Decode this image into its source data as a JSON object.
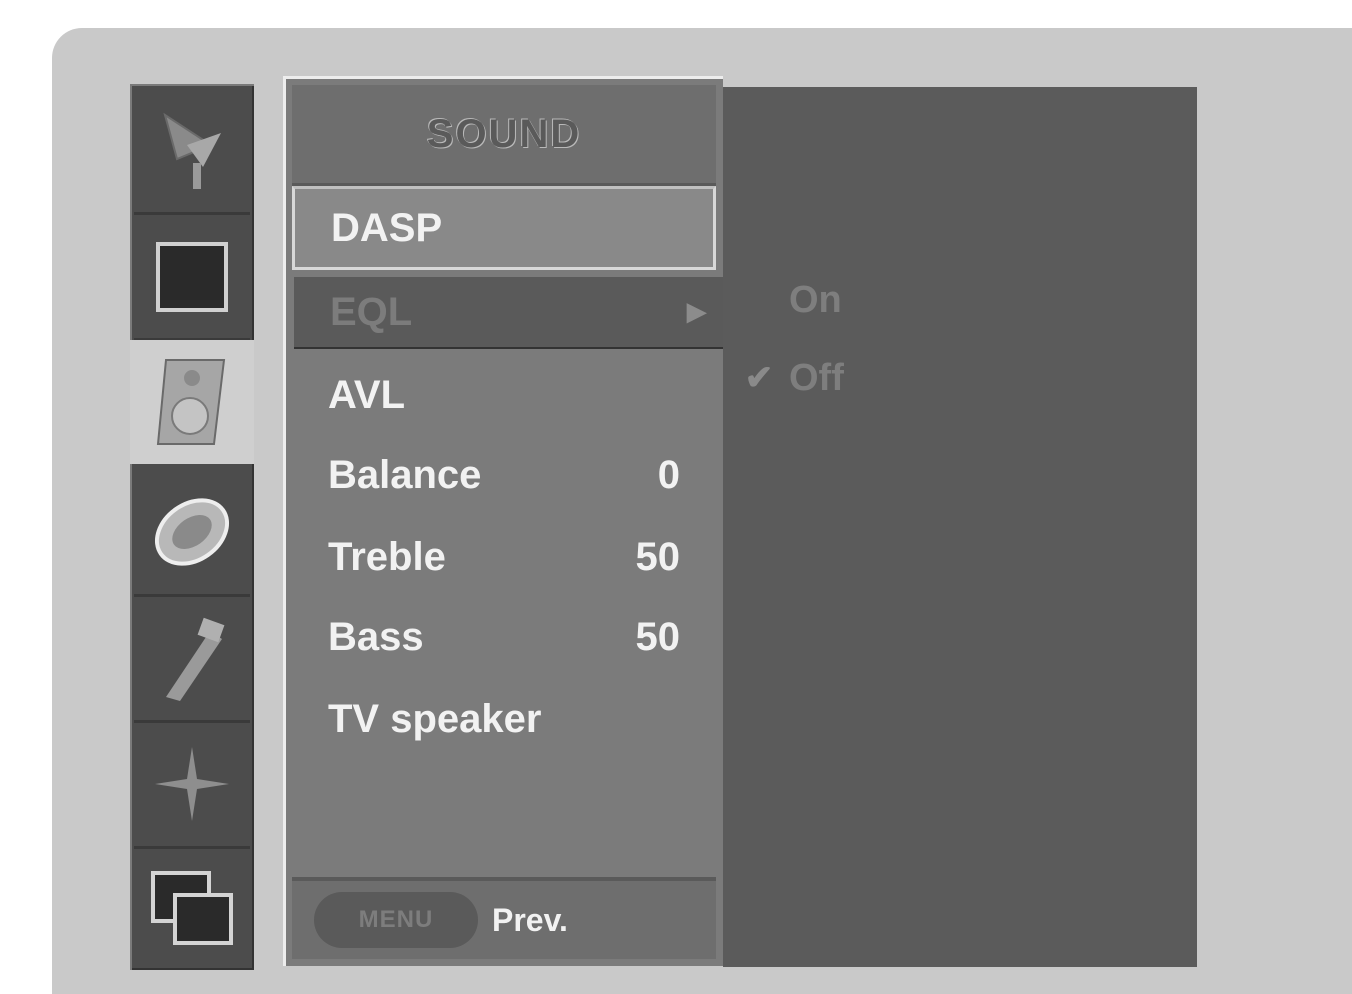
{
  "menu": {
    "title": "SOUND",
    "items": [
      {
        "label": "DASP",
        "value": ""
      },
      {
        "label": "EQL",
        "value": ""
      },
      {
        "label": "AVL",
        "value": ""
      },
      {
        "label": "Balance",
        "value": "0"
      },
      {
        "label": "Treble",
        "value": "50"
      },
      {
        "label": "Bass",
        "value": "50"
      },
      {
        "label": "TV speaker",
        "value": ""
      }
    ],
    "selected_arrow": "►",
    "footer": {
      "button_label": "MENU",
      "prev_label": "Prev."
    }
  },
  "submenu": {
    "options": [
      {
        "label": "On",
        "checked": false,
        "check_mark": ""
      },
      {
        "label": "Off",
        "checked": true,
        "check_mark": "✔"
      }
    ]
  },
  "icons": [
    "antenna-icon",
    "picture-icon",
    "speaker-icon",
    "time-icon",
    "setup-icon",
    "sparkle-icon",
    "input-source-icon"
  ],
  "colors": {
    "background": "#c9c9c9",
    "panel": "#7b7b7b",
    "selected": "#5a5a5a",
    "text": "#f2f2f2"
  }
}
